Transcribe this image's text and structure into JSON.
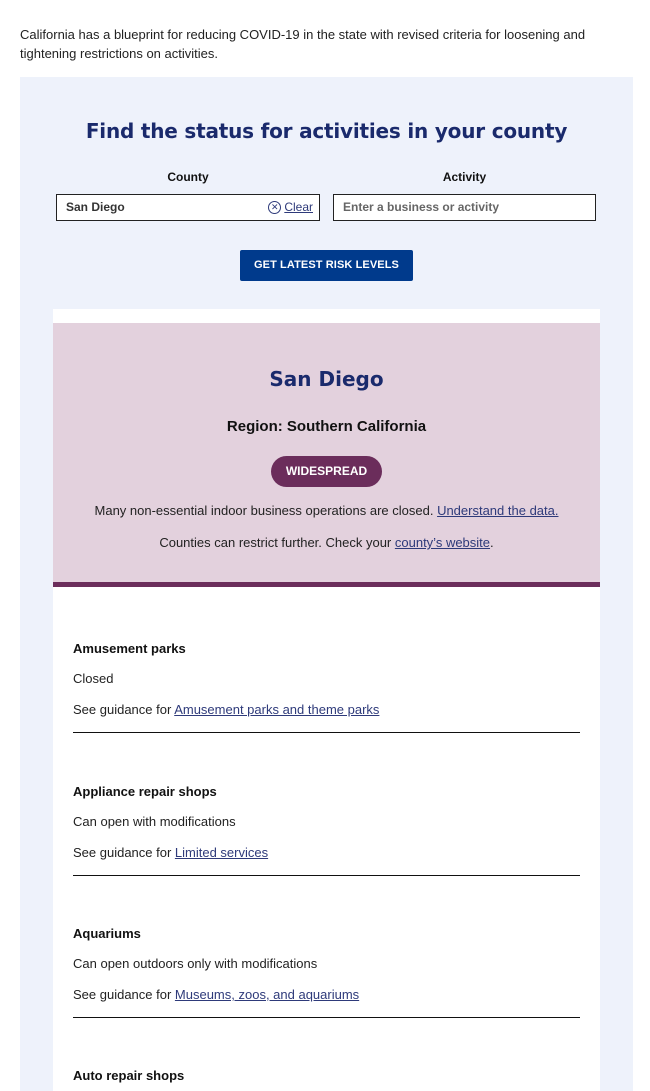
{
  "intro": "California has a blueprint for reducing COVID-19 in the state with revised criteria for loosening and tightening restrictions on activities.",
  "search": {
    "title": "Find the status for activities in your county",
    "county_label": "County",
    "activity_label": "Activity",
    "county_value": "San Diego",
    "clear_label": "Clear",
    "activity_placeholder": "Enter a business or activity",
    "submit_label": "GET LATEST RISK LEVELS"
  },
  "county": {
    "name": "San Diego",
    "region": "Region: Southern California",
    "tier": "WIDESPREAD",
    "tier_color": "#6b2d5b",
    "box_color": "#e3d1dd",
    "line1_text": "Many non-essential indoor business operations are closed. ",
    "line1_link": "Understand the data.",
    "line2_text": "Counties can restrict further. Check your ",
    "line2_link": "county’s website",
    "line2_end": "."
  },
  "guidance_prefix": "See guidance for ",
  "activities": [
    {
      "name": "Amusement parks",
      "status": "Closed",
      "guidance_link": "Amusement parks and theme parks"
    },
    {
      "name": "Appliance repair shops",
      "status": "Can open with modifications",
      "guidance_link": "Limited services"
    },
    {
      "name": "Aquariums",
      "status": "Can open outdoors only with modifications",
      "guidance_link": "Museums, zoos, and aquariums"
    },
    {
      "name": "Auto repair shops"
    }
  ],
  "colors": {
    "panel_bg": "#eef2fb",
    "title": "#1a2a6c",
    "button": "#003a8c",
    "link": "#2e3a7a"
  }
}
